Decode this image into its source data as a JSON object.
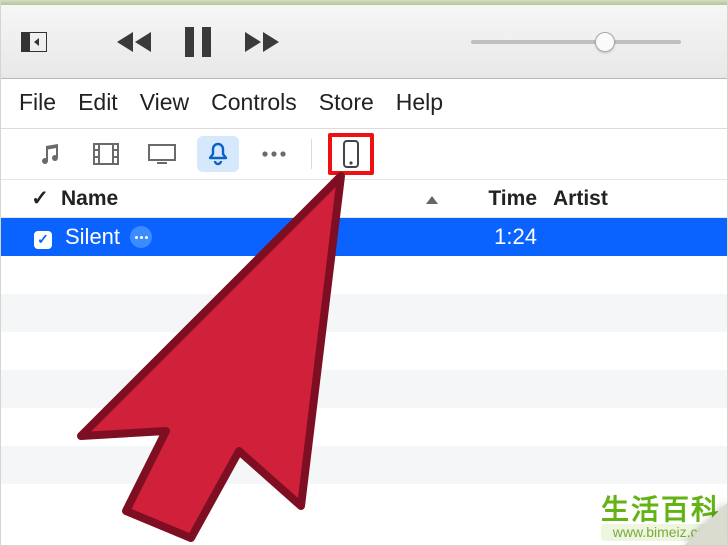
{
  "menubar": {
    "file": "File",
    "edit": "Edit",
    "view": "View",
    "controls": "Controls",
    "store": "Store",
    "help": "Help"
  },
  "headers": {
    "check": "✓",
    "name": "Name",
    "time": "Time",
    "artist": "Artist"
  },
  "icons": {
    "sidebar": "sidebar-layout-icon",
    "prev": "previous-track-icon",
    "play": "play-pause-icon",
    "next": "next-track-icon",
    "music": "music-icon",
    "movies": "movies-icon",
    "tv": "tv-icon",
    "tones": "tones-icon",
    "more": "more-icon",
    "device": "device-iphone-icon",
    "caret": "sort-ascending-icon"
  },
  "volume": {
    "percent": 64
  },
  "tracks": {
    "selected": {
      "checked": true,
      "name": "Silent",
      "time": "1:24",
      "artist": ""
    }
  },
  "watermark": {
    "cn": "生活百科",
    "url": "www.bimeiz.com"
  }
}
